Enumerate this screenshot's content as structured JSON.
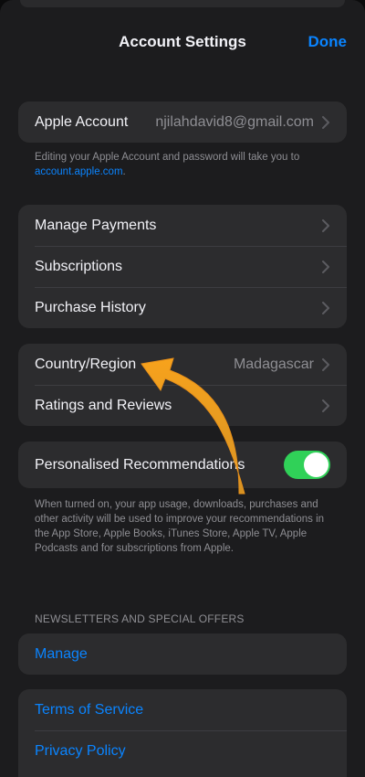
{
  "nav": {
    "title": "Account Settings",
    "done_label": "Done"
  },
  "apple_account": {
    "label": "Apple Account",
    "email": "njilahdavid8@gmail.com",
    "footnote_text": "Editing your Apple Account and password will take you to ",
    "footnote_link": "account.apple.com",
    "footnote_end": "."
  },
  "payments_group": {
    "items": [
      {
        "label": "Manage Payments"
      },
      {
        "label": "Subscriptions"
      },
      {
        "label": "Purchase History"
      }
    ]
  },
  "region_group": {
    "country_label": "Country/Region",
    "country_value": "Madagascar",
    "ratings_label": "Ratings and Reviews"
  },
  "recommendations": {
    "label": "Personalised Recommendations",
    "toggle_on": true,
    "toggle_color": "#30d158",
    "footnote": "When turned on, your app usage, downloads, purchases and other activity will be used to improve your recommendations in the App Store, Apple Books, iTunes Store, Apple TV, Apple Podcasts and for subscriptions from Apple."
  },
  "newsletters": {
    "header": "NEWSLETTERS AND SPECIAL OFFERS",
    "manage_label": "Manage"
  },
  "legal": {
    "terms_label": "Terms of Service",
    "privacy_label": "Privacy Policy"
  },
  "colors": {
    "accent": "#0a84ff",
    "annotation_arrow": "#f5a623"
  }
}
